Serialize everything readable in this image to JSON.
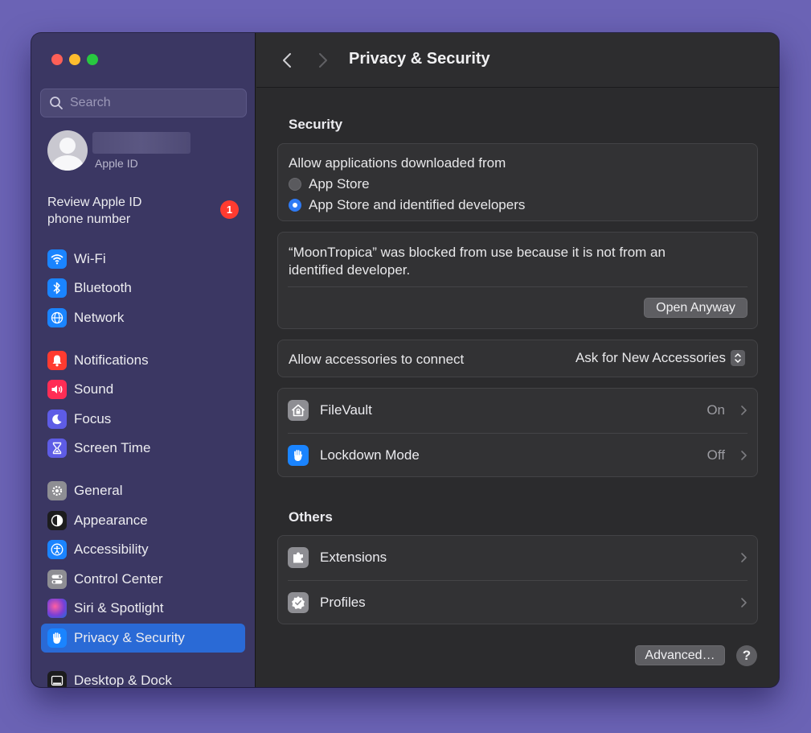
{
  "window": {
    "title": "Privacy & Security"
  },
  "search": {
    "placeholder": "Search",
    "value": ""
  },
  "apple_id": {
    "label": "Apple ID"
  },
  "review": {
    "text_line1": "Review Apple ID",
    "text_line2": "phone number",
    "badge": "1"
  },
  "sidebar": {
    "items": [
      {
        "label": "Wi-Fi",
        "icon": "wifi-icon",
        "color": "#1a84ff"
      },
      {
        "label": "Bluetooth",
        "icon": "bluetooth-icon",
        "color": "#1a84ff"
      },
      {
        "label": "Network",
        "icon": "globe-icon",
        "color": "#1a84ff"
      },
      {
        "label": "Notifications",
        "icon": "bell-icon",
        "color": "#ff3b30"
      },
      {
        "label": "Sound",
        "icon": "speaker-icon",
        "color": "#ff2d55"
      },
      {
        "label": "Focus",
        "icon": "moon-icon",
        "color": "#5e5ce6"
      },
      {
        "label": "Screen Time",
        "icon": "hourglass-icon",
        "color": "#5e5ce6"
      },
      {
        "label": "General",
        "icon": "gear-icon",
        "color": "#8e8e93"
      },
      {
        "label": "Appearance",
        "icon": "appearance-icon",
        "color": "#1c1c1e"
      },
      {
        "label": "Accessibility",
        "icon": "accessibility-icon",
        "color": "#1a84ff"
      },
      {
        "label": "Control Center",
        "icon": "toggles-icon",
        "color": "#8e8e93"
      },
      {
        "label": "Siri & Spotlight",
        "icon": "siri-icon",
        "color": "#a04fd6"
      },
      {
        "label": "Privacy & Security",
        "icon": "hand-icon",
        "color": "#1a84ff",
        "selected": true
      },
      {
        "label": "Desktop & Dock",
        "icon": "dock-icon",
        "color": "#1c1c1e"
      }
    ]
  },
  "security": {
    "heading": "Security",
    "allow_label": "Allow applications downloaded from",
    "options": [
      {
        "label": "App Store",
        "selected": false
      },
      {
        "label": "App Store and identified developers",
        "selected": true
      }
    ],
    "blocked_line1": "“MoonTropica” was blocked from use because it is not from an",
    "blocked_line2": "identified developer.",
    "open_anyway": "Open Anyway",
    "accessories_label": "Allow accessories to connect",
    "accessories_value": "Ask for New Accessories",
    "filevault_label": "FileVault",
    "filevault_value": "On",
    "lockdown_label": "Lockdown Mode",
    "lockdown_value": "Off"
  },
  "others": {
    "heading": "Others",
    "extensions_label": "Extensions",
    "profiles_label": "Profiles"
  },
  "footer": {
    "advanced": "Advanced…",
    "help": "?"
  }
}
